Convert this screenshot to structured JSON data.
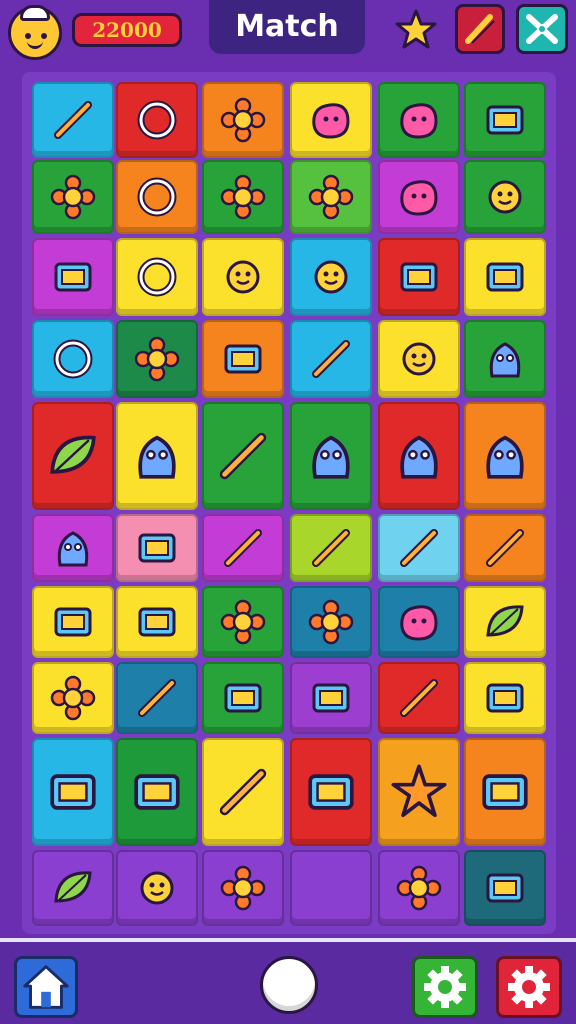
{
  "header": {
    "score": "22000",
    "title": "Match"
  },
  "colors": {
    "background": "#6a2fb0",
    "title_bar": "#3d2480",
    "score_bg": "#e3243a",
    "score_text": "#ffd23a"
  },
  "board": {
    "tiles": [
      {
        "color": "#27b7e6",
        "icon": "crossed-tools-icon"
      },
      {
        "color": "#e02a2a",
        "icon": "magnifier-ball-icon"
      },
      {
        "color": "#f5841f",
        "icon": "sun-flower-icon"
      },
      {
        "color": "#fbe12b",
        "icon": "number-two-icon"
      },
      {
        "color": "#27a33a",
        "icon": "spinning-top-icon"
      },
      {
        "color": "#27a33a",
        "icon": "speaker-box-icon"
      },
      {
        "color": "#27a33a",
        "icon": "sunflower-icon"
      },
      {
        "color": "#f5841f",
        "icon": "disc-record-icon"
      },
      {
        "color": "#27a33a",
        "icon": "blue-flower-icon"
      },
      {
        "color": "#56c13e",
        "icon": "flower-pot-icon"
      },
      {
        "color": "#c33cd6",
        "icon": "potted-plant-icon"
      },
      {
        "color": "#27a33a",
        "icon": "cat-icon"
      },
      {
        "color": "#c33cd6",
        "icon": "radio-icon"
      },
      {
        "color": "#fbe12b",
        "icon": "gear-ring-icon"
      },
      {
        "color": "#fbe12b",
        "icon": "fox-face-icon"
      },
      {
        "color": "#27b7e6",
        "icon": "crab-icon"
      },
      {
        "color": "#e02a2a",
        "icon": "cassette-icon"
      },
      {
        "color": "#fbe12b",
        "icon": "scroll-music-icon"
      },
      {
        "color": "#27b7e6",
        "icon": "ring-icon"
      },
      {
        "color": "#1e8a4a",
        "icon": "orange-flower-icon"
      },
      {
        "color": "#f5841f",
        "icon": "camera-icon"
      },
      {
        "color": "#27b7e6",
        "icon": "wand-icon"
      },
      {
        "color": "#fbe12b",
        "icon": "bird-icon"
      },
      {
        "color": "#27a33a",
        "icon": "fish-icon"
      },
      {
        "color": "#e02a2a",
        "icon": "leaf-icon",
        "tall": true
      },
      {
        "color": "#fbe12b",
        "icon": "seahorse-icon",
        "tall": true
      },
      {
        "color": "#27a33a",
        "icon": "torch-bowl-icon",
        "tall": true
      },
      {
        "color": "#27a33a",
        "icon": "squid-character-icon",
        "tall": true
      },
      {
        "color": "#e02a2a",
        "icon": "octopus-icon",
        "tall": true
      },
      {
        "color": "#f5841f",
        "icon": "robot-bear-icon",
        "tall": true
      },
      {
        "color": "#c33cd6",
        "icon": "starfish-icon"
      },
      {
        "color": "#f48fb1",
        "icon": "tape-icon"
      },
      {
        "color": "#c33cd6",
        "icon": "feather-icon"
      },
      {
        "color": "#a8d62a",
        "icon": "pencil-icon"
      },
      {
        "color": "#6fd3f0",
        "icon": "marker-icon"
      },
      {
        "color": "#f5841f",
        "icon": "pen-icon"
      },
      {
        "color": "#fbe12b",
        "icon": "tv-frame-icon"
      },
      {
        "color": "#fbe12b",
        "icon": "eraser-icon"
      },
      {
        "color": "#27a33a",
        "icon": "red-sun-icon"
      },
      {
        "color": "#1e7fa8",
        "icon": "purple-flower-icon"
      },
      {
        "color": "#1e7fa8",
        "icon": "flame-fox-icon"
      },
      {
        "color": "#fbe12b",
        "icon": "lemon-icon"
      },
      {
        "color": "#fbe12b",
        "icon": "turtle-icon"
      },
      {
        "color": "#1e7fa8",
        "icon": "lollipop-icon"
      },
      {
        "color": "#27a33a",
        "icon": "radio-camera-icon"
      },
      {
        "color": "#9c3fd0",
        "icon": "book-icon"
      },
      {
        "color": "#e02a2a",
        "icon": "key-icon"
      },
      {
        "color": "#fbe12b",
        "icon": "film-roll-icon"
      },
      {
        "color": "#27b7e6",
        "icon": "speech-monitor-icon",
        "tall": true
      },
      {
        "color": "#1e9a3a",
        "icon": "projector-icon",
        "tall": true
      },
      {
        "color": "#fbe12b",
        "icon": "star-wand-icon",
        "tall": true
      },
      {
        "color": "#e02a2a",
        "icon": "crown-box-icon",
        "tall": true
      },
      {
        "color": "#f5a01f",
        "icon": "ribbon-badge-icon",
        "tall": true
      },
      {
        "color": "#f5841f",
        "icon": "computer-icon",
        "tall": true
      },
      {
        "color": "#8a3fd0",
        "icon": "leaf-fruit-icon"
      },
      {
        "color": "#8a3fd0",
        "icon": "chick-icon"
      },
      {
        "color": "#8a3fd0",
        "icon": "orange-sprocket-icon"
      },
      {
        "color": "#8a3fd0",
        "icon": "empty-icon"
      },
      {
        "color": "#8a3fd0",
        "icon": "green-blob-icon"
      },
      {
        "color": "#1e6a7a",
        "icon": "jar-icon"
      }
    ]
  },
  "footer": {
    "home": "home-icon",
    "center": "circle-button-icon",
    "settings_green": "gear-icon",
    "settings_red": "gear-icon"
  }
}
